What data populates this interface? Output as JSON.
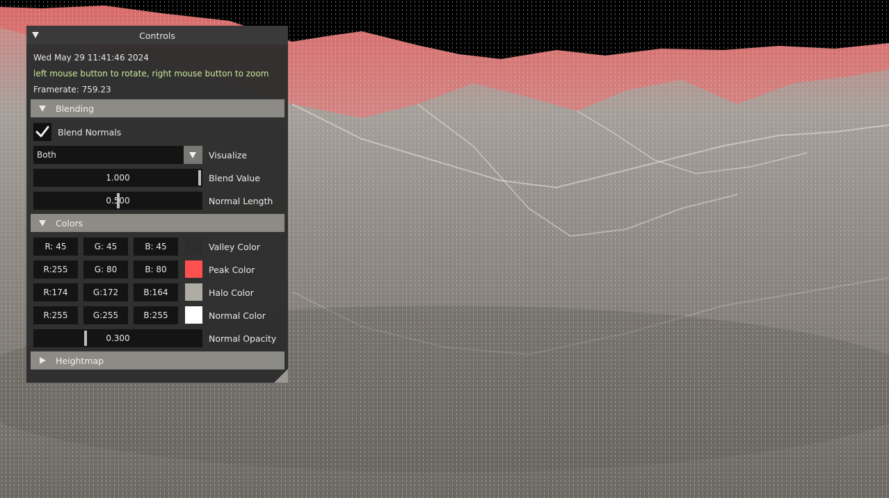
{
  "panel": {
    "title": "Controls",
    "timestamp": "Wed May 29 11:41:46 2024",
    "hint": "left mouse button to rotate, right mouse button to zoom",
    "framerate": "Framerate: 759.23"
  },
  "blending": {
    "header": "Blending",
    "blend_normals": {
      "label": "Blend Normals",
      "checked": true
    },
    "visualize": {
      "value": "Both",
      "label": "Visualize"
    },
    "blend_value": {
      "value": "1.000",
      "label": "Blend Value",
      "fraction": 1.0
    },
    "normal_length": {
      "value": "0.500",
      "label": "Normal Length",
      "fraction": 0.5
    }
  },
  "colors": {
    "header": "Colors",
    "rows": [
      {
        "r": "R: 45",
        "g": "G: 45",
        "b": "B: 45",
        "label": "Valley Color",
        "swatch": "#2d2d2d"
      },
      {
        "r": "R:255",
        "g": "G: 80",
        "b": "B: 80",
        "label": "Peak Color",
        "swatch": "#ff5050"
      },
      {
        "r": "R:174",
        "g": "G:172",
        "b": "B:164",
        "label": "Halo Color",
        "swatch": "#aeaca4"
      },
      {
        "r": "R:255",
        "g": "G:255",
        "b": "B:255",
        "label": "Normal Color",
        "swatch": "#ffffff"
      }
    ],
    "normal_opacity": {
      "value": "0.300",
      "label": "Normal Opacity",
      "fraction": 0.3
    }
  },
  "heightmap": {
    "header": "Heightmap",
    "expanded": false
  },
  "icons": {
    "collapse": "triangle-down-icon",
    "expand": "triangle-right-icon",
    "check": "checkmark-icon",
    "resize": "resize-grip-icon"
  }
}
